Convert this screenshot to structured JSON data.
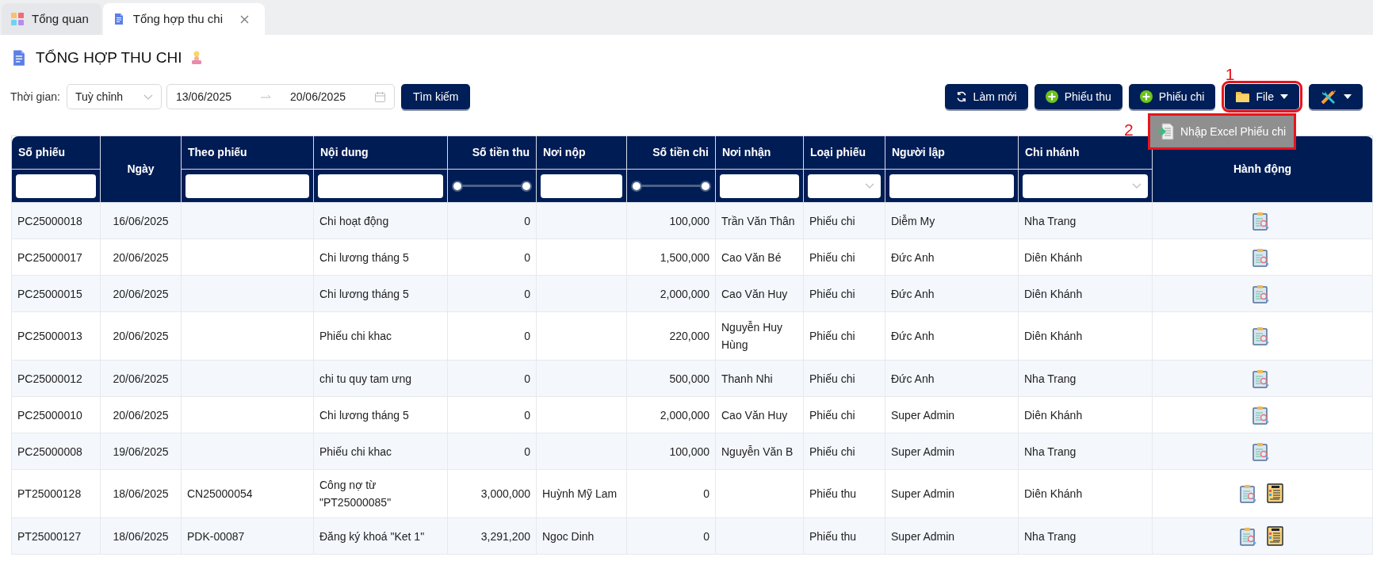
{
  "tabs": [
    {
      "label": "Tổng quan",
      "selected": false,
      "kind": "grid",
      "closable": false
    },
    {
      "label": "Tổng hợp thu chi",
      "selected": true,
      "kind": "doc",
      "closable": true
    }
  ],
  "page_title": "TỔNG HỢP THU CHI",
  "filter": {
    "label": "Thời gian:",
    "period": "Tuỳ chỉnh",
    "date_from": "13/06/2025",
    "date_to": "20/06/2025",
    "search_button": "Tìm kiếm"
  },
  "toolbar": [
    {
      "kind": "refresh",
      "label": "Làm mới",
      "highlighted": false
    },
    {
      "kind": "add",
      "label": "Phiếu thu",
      "highlighted": false
    },
    {
      "kind": "add",
      "label": "Phiếu chi",
      "highlighted": false
    },
    {
      "kind": "file",
      "label": "File",
      "highlighted": true,
      "annotation": "1"
    },
    {
      "kind": "tools",
      "highlighted": false
    }
  ],
  "file_menu": {
    "annotation": "2",
    "items": [
      {
        "label": "Nhập Excel Phiếu chi",
        "highlighted": true
      }
    ]
  },
  "table": {
    "columns": [
      {
        "label": "Số phiếu",
        "filter": {
          "kind": "text"
        }
      },
      {
        "label": "Ngày"
      },
      {
        "label": "Theo phiếu",
        "filter": {
          "kind": "text"
        }
      },
      {
        "label": "Nội dung",
        "filter": {
          "kind": "text"
        }
      },
      {
        "label": "Số tiền thu",
        "filter": {
          "kind": "range",
          "level": 1
        }
      },
      {
        "label": "Nơi nộp",
        "filter": {
          "kind": "text"
        }
      },
      {
        "label": "Số tiền chi",
        "filter": {
          "kind": "range",
          "level": 1
        }
      },
      {
        "label": "Nơi nhận",
        "filter": {
          "kind": "text"
        }
      },
      {
        "label": "Loại phiếu",
        "filter": {
          "kind": "select"
        }
      },
      {
        "label": "Người lập",
        "filter": {
          "kind": "text"
        }
      },
      {
        "label": "Chi nhánh",
        "filter": {
          "kind": "select"
        }
      },
      {
        "label": "Hành động"
      }
    ],
    "rows": [
      {
        "cells": [
          "PC25000018",
          "16/06/2025",
          "",
          "Chi hoạt động",
          "0",
          "",
          "100,000",
          "Trần Văn Thân",
          "Phiếu chi",
          "Diễm My",
          "Nha Trang"
        ],
        "actions": [
          {
            "kind": "view"
          }
        ]
      },
      {
        "cells": [
          "PC25000017",
          "20/06/2025",
          "",
          "Chi lương tháng 5",
          "0",
          "",
          "1,500,000",
          "Cao Văn Bé",
          "Phiếu chi",
          "Đức Anh",
          "Diên Khánh"
        ],
        "actions": [
          {
            "kind": "view"
          }
        ]
      },
      {
        "cells": [
          "PC25000015",
          "20/06/2025",
          "",
          "Chi lương tháng 5",
          "0",
          "",
          "2,000,000",
          "Cao Văn Huy",
          "Phiếu chi",
          "Đức Anh",
          "Diên Khánh"
        ],
        "actions": [
          {
            "kind": "view"
          }
        ]
      },
      {
        "cells": [
          "PC25000013",
          "20/06/2025",
          "",
          "Phiếu chi khac",
          "0",
          "",
          "220,000",
          "Nguyễn Huy Hùng",
          "Phiếu chi",
          "Đức Anh",
          "Diên Khánh"
        ],
        "actions": [
          {
            "kind": "view"
          }
        ]
      },
      {
        "cells": [
          "PC25000012",
          "20/06/2025",
          "",
          "chi tu quy tam ưng",
          "0",
          "",
          "500,000",
          "Thanh Nhi",
          "Phiếu chi",
          "Đức Anh",
          "Nha Trang"
        ],
        "actions": [
          {
            "kind": "view"
          }
        ]
      },
      {
        "cells": [
          "PC25000010",
          "20/06/2025",
          "",
          "Chi lương tháng 5",
          "0",
          "",
          "2,000,000",
          "Cao Văn Huy",
          "Phiếu chi",
          "Super Admin",
          "Diên Khánh"
        ],
        "actions": [
          {
            "kind": "view"
          }
        ]
      },
      {
        "cells": [
          "PC25000008",
          "19/06/2025",
          "",
          "Phiếu chi khac",
          "0",
          "",
          "100,000",
          "Nguyễn Văn B",
          "Phiếu chi",
          "Super Admin",
          "Nha Trang"
        ],
        "actions": [
          {
            "kind": "view"
          }
        ]
      },
      {
        "cells": [
          "PT25000128",
          "18/06/2025",
          "CN25000054",
          "Công nợ từ \"PT25000085\"",
          "3,000,000",
          "Huỳnh Mỹ Lam",
          "0",
          "",
          "Phiếu thu",
          "Super Admin",
          "Diên Khánh"
        ],
        "actions": [
          {
            "kind": "view"
          },
          {
            "kind": "info"
          }
        ]
      },
      {
        "cells": [
          "PT25000127",
          "18/06/2025",
          "PDK-00087",
          "Đăng ký khoá \"Ket 1\"",
          "3,291,200",
          "Ngoc Dinh",
          "0",
          "",
          "Phiếu thu",
          "Super Admin",
          "Nha Trang"
        ],
        "actions": [
          {
            "kind": "view"
          },
          {
            "kind": "info"
          }
        ]
      }
    ]
  }
}
